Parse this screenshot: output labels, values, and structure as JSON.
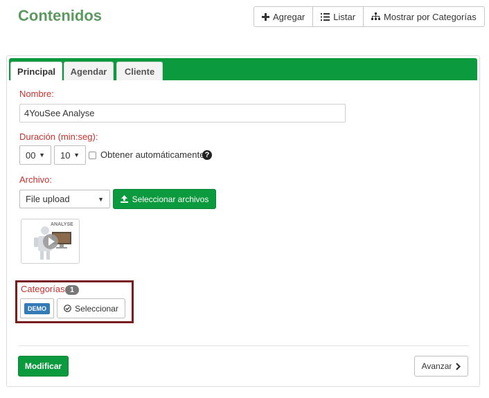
{
  "page": {
    "title": "Contenidos"
  },
  "toolbar": {
    "add_label": "Agregar",
    "list_label": "Listar",
    "categories_label": "Mostrar por Categorías"
  },
  "tabs": [
    {
      "label": "Principal",
      "active": true
    },
    {
      "label": "Agendar",
      "active": false
    },
    {
      "label": "Cliente",
      "active": false
    }
  ],
  "form": {
    "name_label": "Nombre:",
    "name_value": "4YouSee Analyse",
    "duration_label": "Duración (min:seg):",
    "minutes_value": "00",
    "seconds_value": "10",
    "auto_label": "Obtener automáticamente",
    "auto_checked": false,
    "file_label": "Archivo:",
    "file_type_value": "File upload",
    "select_files_label": "Seleccionar archivos",
    "thumbnail_text": "ANALYSE",
    "categories_label": "Categorías:",
    "categories_count": "1",
    "category_tag": "DEMO",
    "select_category_label": "Seleccionar"
  },
  "footer": {
    "modify_label": "Modificar",
    "next_label": "Avanzar"
  },
  "colors": {
    "title_green": "#5b9a5e",
    "tab_bar_green": "#0b9a3d",
    "label_red": "#c9302c",
    "highlight_border": "#7a1d1f",
    "demo_blue": "#337ab7"
  }
}
